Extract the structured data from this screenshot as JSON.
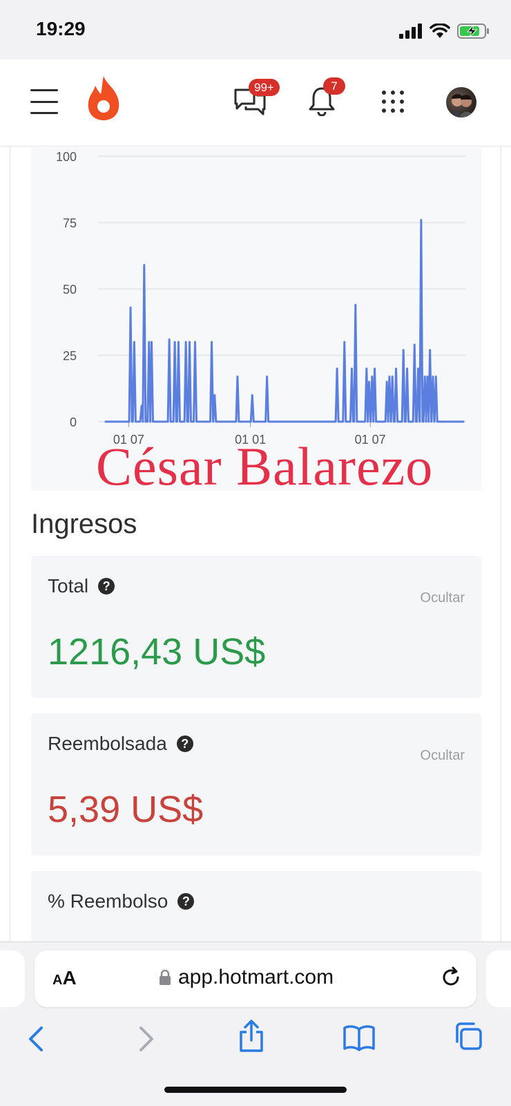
{
  "status_bar": {
    "time": "19:29"
  },
  "header": {
    "messages_badge": "99+",
    "notifications_badge": "7"
  },
  "chart_data": {
    "type": "bar",
    "title": "",
    "xlabel": "",
    "ylabel": "",
    "ylim": [
      0,
      100
    ],
    "y_ticks": [
      "100",
      "75",
      "50",
      "25",
      "0"
    ],
    "x_ticks": [
      "01 07",
      "01 01",
      "01 07"
    ],
    "grid": true,
    "legend": "none",
    "color": "#5b7fdf",
    "series": [
      {
        "values": [
          {
            "x": 0.02,
            "y": 0
          },
          {
            "x": 0.09,
            "y": 43
          },
          {
            "x": 0.1,
            "y": 30
          },
          {
            "x": 0.12,
            "y": 6
          },
          {
            "x": 0.127,
            "y": 59
          },
          {
            "x": 0.14,
            "y": 30
          },
          {
            "x": 0.147,
            "y": 30
          },
          {
            "x": 0.195,
            "y": 31
          },
          {
            "x": 0.21,
            "y": 30
          },
          {
            "x": 0.22,
            "y": 30
          },
          {
            "x": 0.24,
            "y": 30
          },
          {
            "x": 0.25,
            "y": 30
          },
          {
            "x": 0.265,
            "y": 30
          },
          {
            "x": 0.31,
            "y": 30
          },
          {
            "x": 0.318,
            "y": 10
          },
          {
            "x": 0.38,
            "y": 17
          },
          {
            "x": 0.42,
            "y": 10
          },
          {
            "x": 0.46,
            "y": 17
          },
          {
            "x": 0.65,
            "y": 20
          },
          {
            "x": 0.67,
            "y": 30
          },
          {
            "x": 0.69,
            "y": 20
          },
          {
            "x": 0.7,
            "y": 44
          },
          {
            "x": 0.73,
            "y": 20
          },
          {
            "x": 0.737,
            "y": 15
          },
          {
            "x": 0.745,
            "y": 17
          },
          {
            "x": 0.752,
            "y": 20
          },
          {
            "x": 0.785,
            "y": 15
          },
          {
            "x": 0.792,
            "y": 17
          },
          {
            "x": 0.8,
            "y": 17
          },
          {
            "x": 0.81,
            "y": 20
          },
          {
            "x": 0.83,
            "y": 27
          },
          {
            "x": 0.84,
            "y": 20
          },
          {
            "x": 0.86,
            "y": 29
          },
          {
            "x": 0.87,
            "y": 20
          },
          {
            "x": 0.878,
            "y": 76
          },
          {
            "x": 0.888,
            "y": 17
          },
          {
            "x": 0.895,
            "y": 17
          },
          {
            "x": 0.902,
            "y": 27
          },
          {
            "x": 0.91,
            "y": 17
          },
          {
            "x": 0.918,
            "y": 17
          },
          {
            "x": 0.995,
            "y": 0
          }
        ]
      }
    ],
    "watermark": "César Balarezo"
  },
  "ingresos": {
    "title": "Ingresos",
    "cards": [
      {
        "label": "Total",
        "hide": "Ocultar",
        "value": "1216,43 US$",
        "color": "#2b9a4a"
      },
      {
        "label": "Reembolsada",
        "hide": "Ocultar",
        "value": "5,39 US$",
        "color": "#c8433b"
      },
      {
        "label": "% Reembolso"
      }
    ]
  },
  "browser": {
    "text_size": "AA",
    "url": "app.hotmart.com"
  }
}
